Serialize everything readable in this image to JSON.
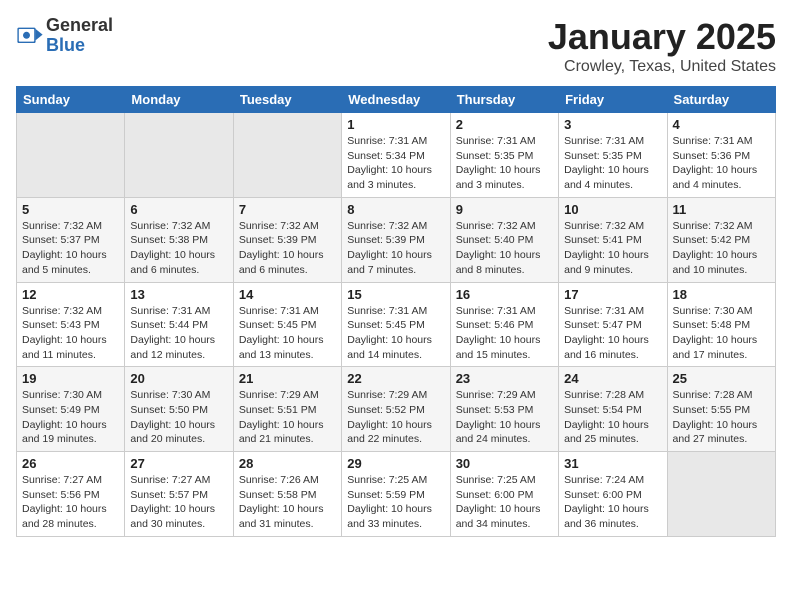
{
  "logo": {
    "general": "General",
    "blue": "Blue"
  },
  "title": "January 2025",
  "location": "Crowley, Texas, United States",
  "weekdays": [
    "Sunday",
    "Monday",
    "Tuesday",
    "Wednesday",
    "Thursday",
    "Friday",
    "Saturday"
  ],
  "weeks": [
    [
      {
        "day": "",
        "info": ""
      },
      {
        "day": "",
        "info": ""
      },
      {
        "day": "",
        "info": ""
      },
      {
        "day": "1",
        "info": "Sunrise: 7:31 AM\nSunset: 5:34 PM\nDaylight: 10 hours\nand 3 minutes."
      },
      {
        "day": "2",
        "info": "Sunrise: 7:31 AM\nSunset: 5:35 PM\nDaylight: 10 hours\nand 3 minutes."
      },
      {
        "day": "3",
        "info": "Sunrise: 7:31 AM\nSunset: 5:35 PM\nDaylight: 10 hours\nand 4 minutes."
      },
      {
        "day": "4",
        "info": "Sunrise: 7:31 AM\nSunset: 5:36 PM\nDaylight: 10 hours\nand 4 minutes."
      }
    ],
    [
      {
        "day": "5",
        "info": "Sunrise: 7:32 AM\nSunset: 5:37 PM\nDaylight: 10 hours\nand 5 minutes."
      },
      {
        "day": "6",
        "info": "Sunrise: 7:32 AM\nSunset: 5:38 PM\nDaylight: 10 hours\nand 6 minutes."
      },
      {
        "day": "7",
        "info": "Sunrise: 7:32 AM\nSunset: 5:39 PM\nDaylight: 10 hours\nand 6 minutes."
      },
      {
        "day": "8",
        "info": "Sunrise: 7:32 AM\nSunset: 5:39 PM\nDaylight: 10 hours\nand 7 minutes."
      },
      {
        "day": "9",
        "info": "Sunrise: 7:32 AM\nSunset: 5:40 PM\nDaylight: 10 hours\nand 8 minutes."
      },
      {
        "day": "10",
        "info": "Sunrise: 7:32 AM\nSunset: 5:41 PM\nDaylight: 10 hours\nand 9 minutes."
      },
      {
        "day": "11",
        "info": "Sunrise: 7:32 AM\nSunset: 5:42 PM\nDaylight: 10 hours\nand 10 minutes."
      }
    ],
    [
      {
        "day": "12",
        "info": "Sunrise: 7:32 AM\nSunset: 5:43 PM\nDaylight: 10 hours\nand 11 minutes."
      },
      {
        "day": "13",
        "info": "Sunrise: 7:31 AM\nSunset: 5:44 PM\nDaylight: 10 hours\nand 12 minutes."
      },
      {
        "day": "14",
        "info": "Sunrise: 7:31 AM\nSunset: 5:45 PM\nDaylight: 10 hours\nand 13 minutes."
      },
      {
        "day": "15",
        "info": "Sunrise: 7:31 AM\nSunset: 5:45 PM\nDaylight: 10 hours\nand 14 minutes."
      },
      {
        "day": "16",
        "info": "Sunrise: 7:31 AM\nSunset: 5:46 PM\nDaylight: 10 hours\nand 15 minutes."
      },
      {
        "day": "17",
        "info": "Sunrise: 7:31 AM\nSunset: 5:47 PM\nDaylight: 10 hours\nand 16 minutes."
      },
      {
        "day": "18",
        "info": "Sunrise: 7:30 AM\nSunset: 5:48 PM\nDaylight: 10 hours\nand 17 minutes."
      }
    ],
    [
      {
        "day": "19",
        "info": "Sunrise: 7:30 AM\nSunset: 5:49 PM\nDaylight: 10 hours\nand 19 minutes."
      },
      {
        "day": "20",
        "info": "Sunrise: 7:30 AM\nSunset: 5:50 PM\nDaylight: 10 hours\nand 20 minutes."
      },
      {
        "day": "21",
        "info": "Sunrise: 7:29 AM\nSunset: 5:51 PM\nDaylight: 10 hours\nand 21 minutes."
      },
      {
        "day": "22",
        "info": "Sunrise: 7:29 AM\nSunset: 5:52 PM\nDaylight: 10 hours\nand 22 minutes."
      },
      {
        "day": "23",
        "info": "Sunrise: 7:29 AM\nSunset: 5:53 PM\nDaylight: 10 hours\nand 24 minutes."
      },
      {
        "day": "24",
        "info": "Sunrise: 7:28 AM\nSunset: 5:54 PM\nDaylight: 10 hours\nand 25 minutes."
      },
      {
        "day": "25",
        "info": "Sunrise: 7:28 AM\nSunset: 5:55 PM\nDaylight: 10 hours\nand 27 minutes."
      }
    ],
    [
      {
        "day": "26",
        "info": "Sunrise: 7:27 AM\nSunset: 5:56 PM\nDaylight: 10 hours\nand 28 minutes."
      },
      {
        "day": "27",
        "info": "Sunrise: 7:27 AM\nSunset: 5:57 PM\nDaylight: 10 hours\nand 30 minutes."
      },
      {
        "day": "28",
        "info": "Sunrise: 7:26 AM\nSunset: 5:58 PM\nDaylight: 10 hours\nand 31 minutes."
      },
      {
        "day": "29",
        "info": "Sunrise: 7:25 AM\nSunset: 5:59 PM\nDaylight: 10 hours\nand 33 minutes."
      },
      {
        "day": "30",
        "info": "Sunrise: 7:25 AM\nSunset: 6:00 PM\nDaylight: 10 hours\nand 34 minutes."
      },
      {
        "day": "31",
        "info": "Sunrise: 7:24 AM\nSunset: 6:00 PM\nDaylight: 10 hours\nand 36 minutes."
      },
      {
        "day": "",
        "info": ""
      }
    ]
  ]
}
